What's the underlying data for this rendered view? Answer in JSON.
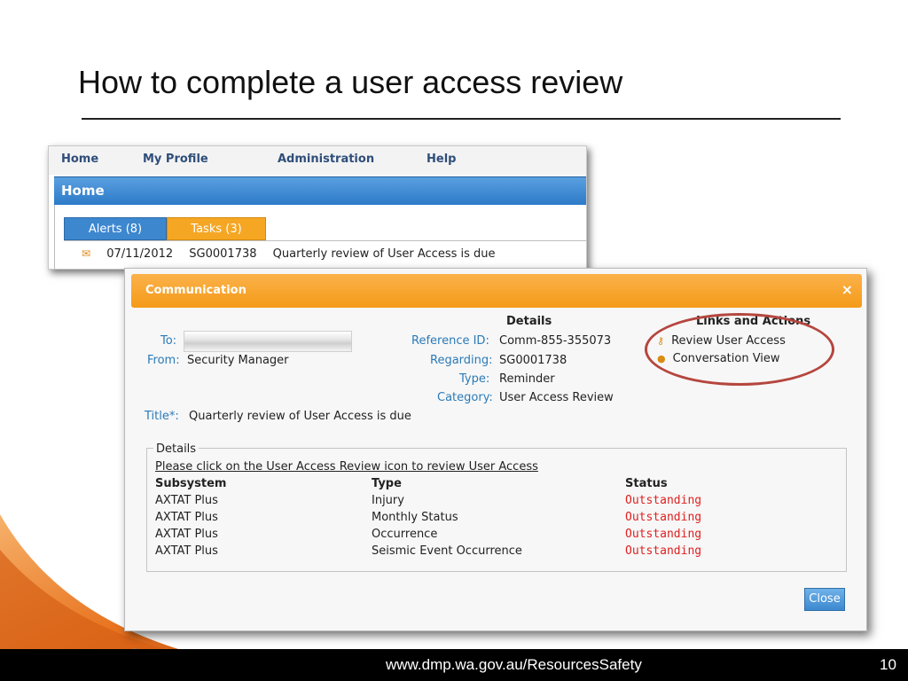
{
  "slide": {
    "title": "How to complete a user access review",
    "footer_url": "www.dmp.wa.gov.au/ResourcesSafety",
    "page_number": "10"
  },
  "app": {
    "nav": [
      "Home",
      "My Profile",
      "Administration",
      "Help"
    ],
    "section_title": "Home",
    "tabs": {
      "alerts": "Alerts (8)",
      "tasks": "Tasks (3)"
    },
    "task_row": {
      "date": "07/11/2012",
      "id": "SG0001738",
      "text": "Quarterly review of User Access is due"
    }
  },
  "dialog": {
    "title": "Communication",
    "close_glyph": "×",
    "to_label": "To:",
    "from_label": "From:",
    "from_value": "Security Manager",
    "details_heading": "Details",
    "reference_label": "Reference ID:",
    "reference_value": "Comm-855-355073",
    "regarding_label": "Regarding:",
    "regarding_value": "SG0001738",
    "type_label": "Type:",
    "type_value": "Reminder",
    "category_label": "Category:",
    "category_value": "User Access Review",
    "title_label": "Title*:",
    "title_value": "Quarterly review of User Access is due",
    "links_heading": "Links and Actions",
    "links": [
      "Review User Access",
      "Conversation View"
    ],
    "details_box": {
      "legend": "Details",
      "instruction": "Please click on the User Access Review icon to review User Access",
      "columns": [
        "Subsystem",
        "Type",
        "Status"
      ],
      "rows": [
        [
          "AXTAT Plus",
          "Injury",
          "Outstanding"
        ],
        [
          "AXTAT Plus",
          "Monthly Status",
          "Outstanding"
        ],
        [
          "AXTAT Plus",
          "Occurrence",
          "Outstanding"
        ],
        [
          "AXTAT Plus",
          "Seismic Event Occurrence",
          "Outstanding"
        ]
      ]
    },
    "close_button": "Close"
  }
}
